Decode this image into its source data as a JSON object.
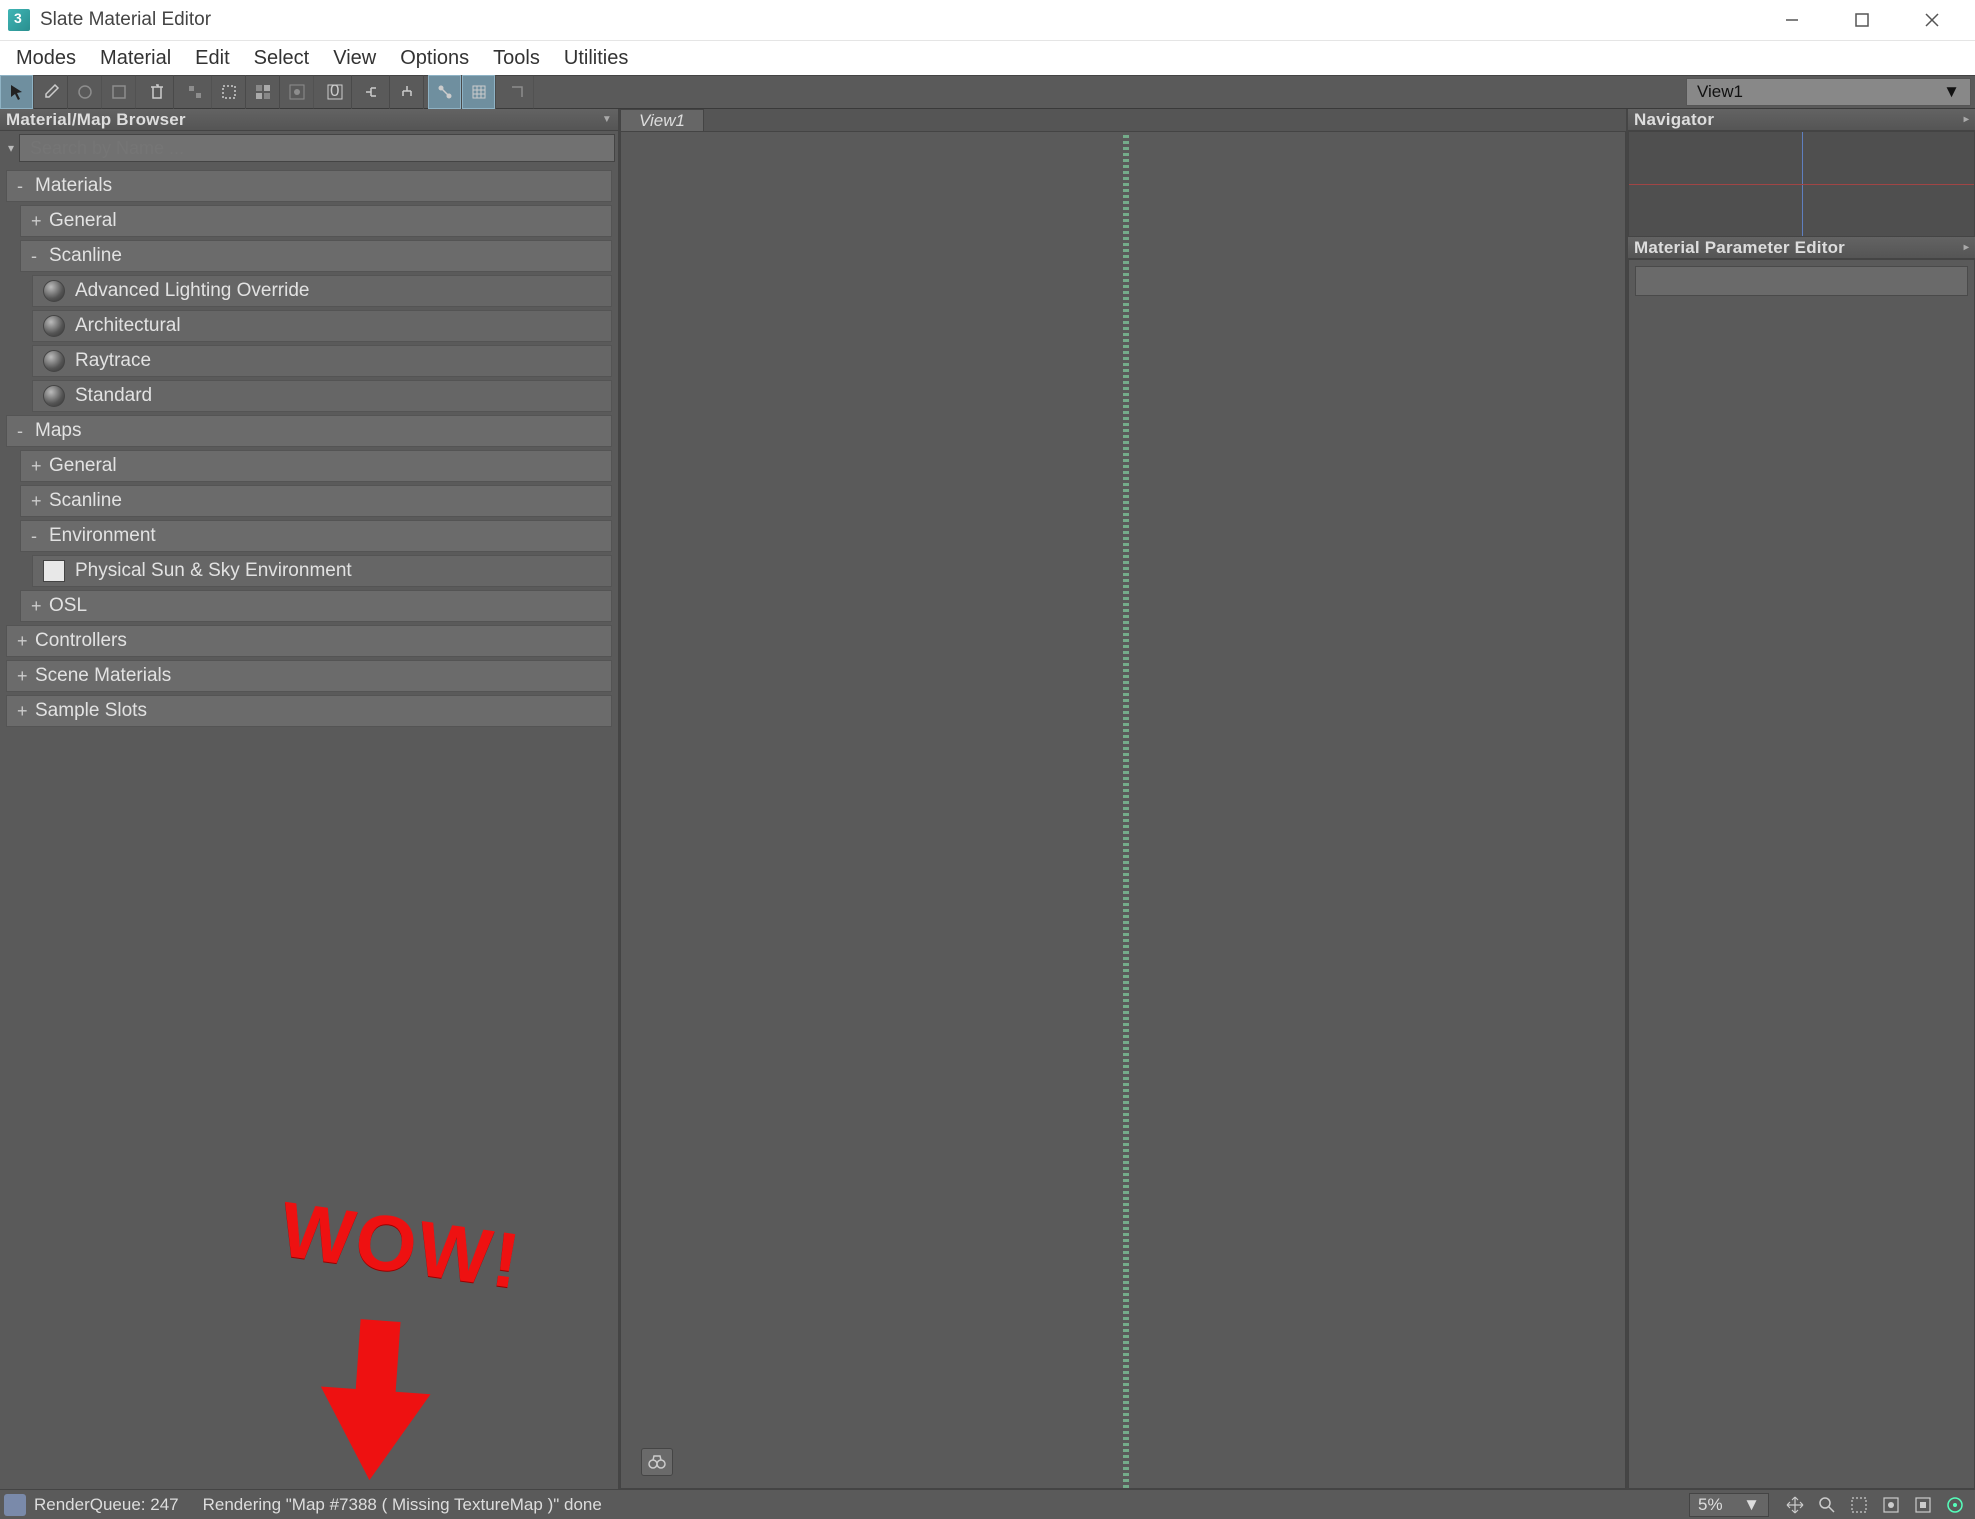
{
  "window": {
    "title": "Slate Material Editor"
  },
  "menu": {
    "items": [
      "Modes",
      "Material",
      "Edit",
      "Select",
      "View",
      "Options",
      "Tools",
      "Utilities"
    ]
  },
  "toolbar": {
    "view_selector": "View1"
  },
  "browser": {
    "panel_title": "Material/Map Browser",
    "search_placeholder": "Search by Name ...",
    "groups": [
      {
        "label": "Materials",
        "expanded": true,
        "level": 0,
        "children": [
          {
            "label": "General",
            "expanded": false,
            "level": 1
          },
          {
            "label": "Scanline",
            "expanded": true,
            "level": 1,
            "children": [
              {
                "label": "Advanced Lighting Override",
                "leaf": true,
                "icon": "sphere",
                "level": 2
              },
              {
                "label": "Architectural",
                "leaf": true,
                "icon": "sphere",
                "level": 2
              },
              {
                "label": "Raytrace",
                "leaf": true,
                "icon": "sphere",
                "level": 2
              },
              {
                "label": "Standard",
                "leaf": true,
                "icon": "sphere",
                "level": 2
              }
            ]
          }
        ]
      },
      {
        "label": "Maps",
        "expanded": true,
        "level": 0,
        "children": [
          {
            "label": "General",
            "expanded": false,
            "level": 1
          },
          {
            "label": "Scanline",
            "expanded": false,
            "level": 1
          },
          {
            "label": "Environment",
            "expanded": true,
            "level": 1,
            "children": [
              {
                "label": "Physical Sun & Sky Environment",
                "leaf": true,
                "icon": "square",
                "level": 2
              }
            ]
          },
          {
            "label": "OSL",
            "expanded": false,
            "level": 1
          }
        ]
      },
      {
        "label": "Controllers",
        "expanded": false,
        "level": 0
      },
      {
        "label": "Scene Materials",
        "expanded": false,
        "level": 0
      },
      {
        "label": "Sample Slots",
        "expanded": false,
        "level": 0
      }
    ]
  },
  "center": {
    "tab": "View1"
  },
  "right": {
    "navigator_title": "Navigator",
    "param_title": "Material Parameter Editor"
  },
  "status": {
    "queue": "RenderQueue: 247",
    "rendering": "Rendering \"Map #7388  ( Missing TextureMap )\" done",
    "zoom": "5%"
  },
  "annotation": {
    "text": "WOW!"
  }
}
